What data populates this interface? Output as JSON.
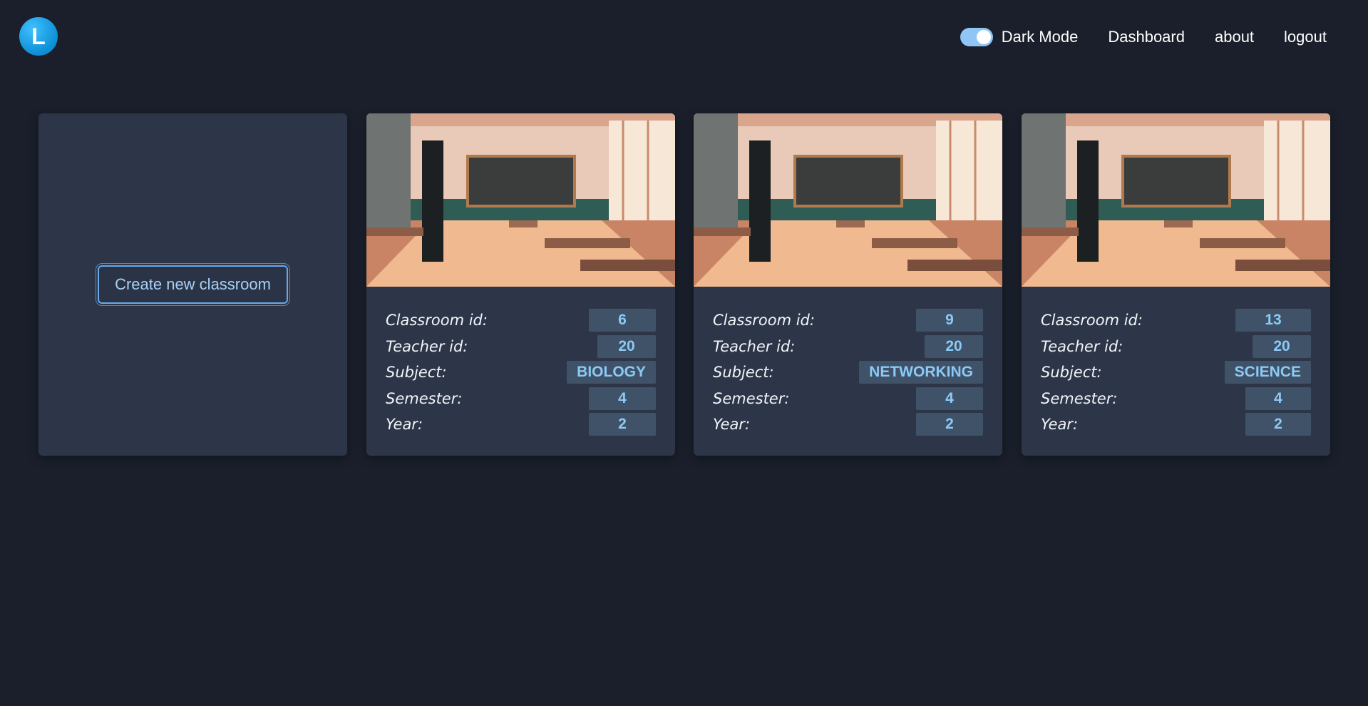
{
  "app": {
    "logo_letter": "L"
  },
  "nav": {
    "dark_mode_label": "Dark Mode",
    "dark_mode_on": true,
    "dashboard": "Dashboard",
    "about": "about",
    "logout": "logout"
  },
  "create_card": {
    "button_label": "Create new classroom"
  },
  "labels": {
    "classroom_id": "Classroom id:",
    "teacher_id": "Teacher id:",
    "subject": "Subject:",
    "semester": "Semester:",
    "year": "Year:"
  },
  "classrooms": [
    {
      "classroom_id": "6",
      "teacher_id": "20",
      "subject": "BIOLOGY",
      "semester": "4",
      "year": "2"
    },
    {
      "classroom_id": "9",
      "teacher_id": "20",
      "subject": "NETWORKING",
      "semester": "4",
      "year": "2"
    },
    {
      "classroom_id": "13",
      "teacher_id": "20",
      "subject": "SCIENCE",
      "semester": "4",
      "year": "2"
    }
  ],
  "colors": {
    "background": "#1a1f2b",
    "card": "#2d3648",
    "value_bg": "#3f5268",
    "value_text": "#8ccaf6",
    "accent": "#0d8fd6"
  }
}
